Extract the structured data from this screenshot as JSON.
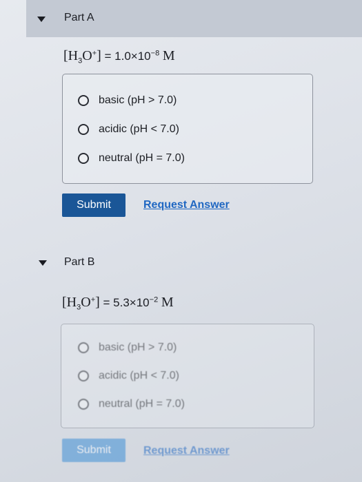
{
  "part_a": {
    "title": "Part A",
    "equation": {
      "lhs_open": "[H",
      "sub": "3",
      "o": "O",
      "sup_charge": "+",
      "lhs_close": "]",
      "equals": " = 1.0×10",
      "exponent": "−8",
      "unit": "M"
    },
    "options": [
      "basic (pH > 7.0)",
      "acidic (pH < 7.0)",
      "neutral (pH = 7.0)"
    ],
    "submit_label": "Submit",
    "request_label": "Request Answer"
  },
  "part_b": {
    "title": "Part B",
    "equation": {
      "lhs_open": "[H",
      "sub": "3",
      "o": "O",
      "sup_charge": "+",
      "lhs_close": "]",
      "equals": " = 5.3×10",
      "exponent": "−2",
      "unit": "M"
    },
    "options": [
      "basic (pH > 7.0)",
      "acidic (pH < 7.0)",
      "neutral (pH = 7.0)"
    ],
    "submit_label": "Submit",
    "request_label": "Request Answer"
  },
  "icons": {
    "collapse": "caret-down-icon"
  },
  "colors": {
    "header_bg": "#c3c9d3",
    "submit_bg": "#1a5697",
    "link": "#1f67c2"
  }
}
